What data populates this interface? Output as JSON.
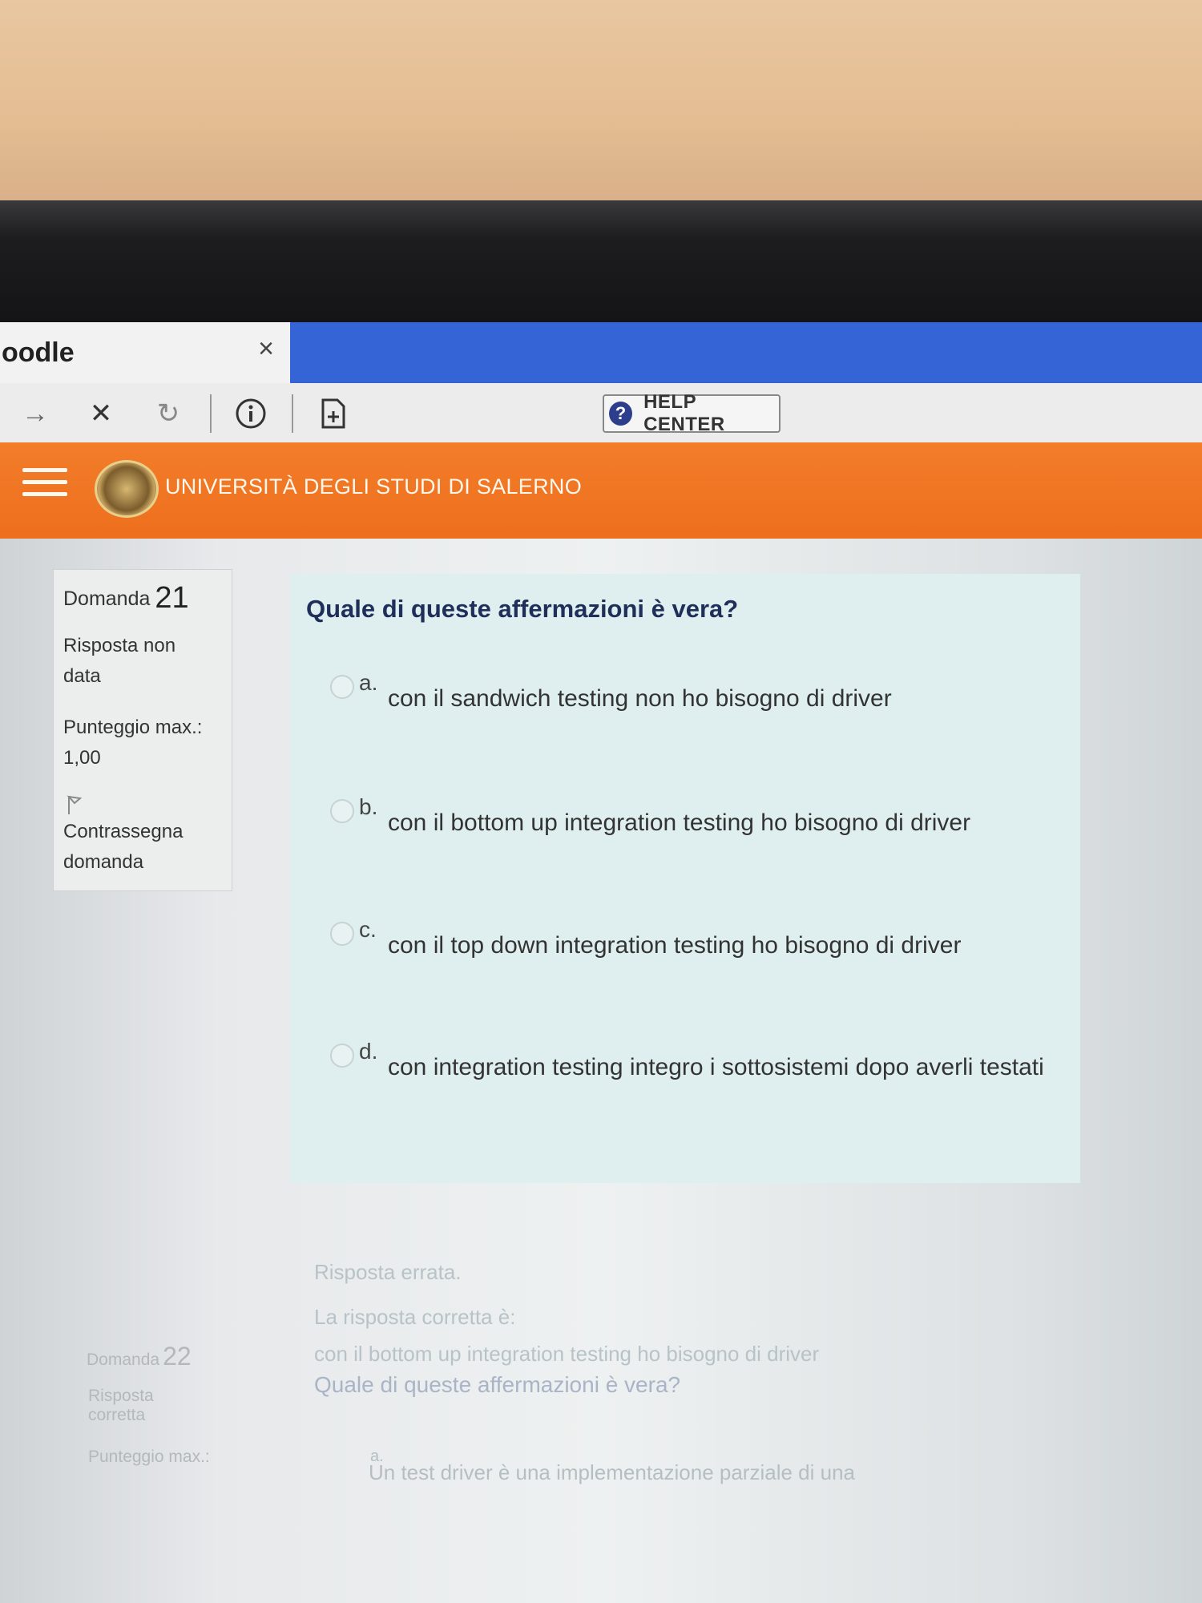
{
  "browser": {
    "tab_title": "oodle",
    "tab_close": "×",
    "toolbar": {
      "forward": "→",
      "stop": "✕",
      "reload": "↻",
      "help_label": "HELP CENTER",
      "help_icon": "?"
    }
  },
  "site": {
    "university": "UNIVERSITÀ DEGLI STUDI DI SALERNO"
  },
  "question21": {
    "label": "Domanda",
    "number": "21",
    "status_line1": "Risposta non",
    "status_line2": "data",
    "score_line1": "Punteggio max.:",
    "score_line2": "1,00",
    "flag_line1": "Contrassegna",
    "flag_line2": "domanda",
    "text": "Quale di queste affermazioni è vera?",
    "options": [
      {
        "letter": "a.",
        "text": "con il sandwich testing non ho bisogno di driver"
      },
      {
        "letter": "b.",
        "text": "con il bottom up integration testing ho bisogno di driver"
      },
      {
        "letter": "c.",
        "text": "con il top down integration testing ho bisogno di driver"
      },
      {
        "letter": "d.",
        "text": "con integration testing integro i sottosistemi dopo averli testati"
      }
    ],
    "feedback": {
      "result": "Risposta errata.",
      "correct_label": "La risposta corretta è:",
      "correct_answer": "con il bottom up integration testing ho bisogno di driver"
    }
  },
  "question22": {
    "label": "Domanda",
    "number": "22",
    "status_line1": "Risposta",
    "status_line2": "corretta",
    "score_line1": "Punteggio max.:",
    "text": "Quale di queste affermazioni è vera?",
    "option_a_letter": "a.",
    "option_a_text": "Un test driver è una implementazione parziale di una"
  },
  "colors": {
    "header_orange": "#ee6f1d",
    "tab_bar_blue": "#3564d6",
    "question_bg": "#dfeff0",
    "question_text": "#1f2f5a"
  }
}
